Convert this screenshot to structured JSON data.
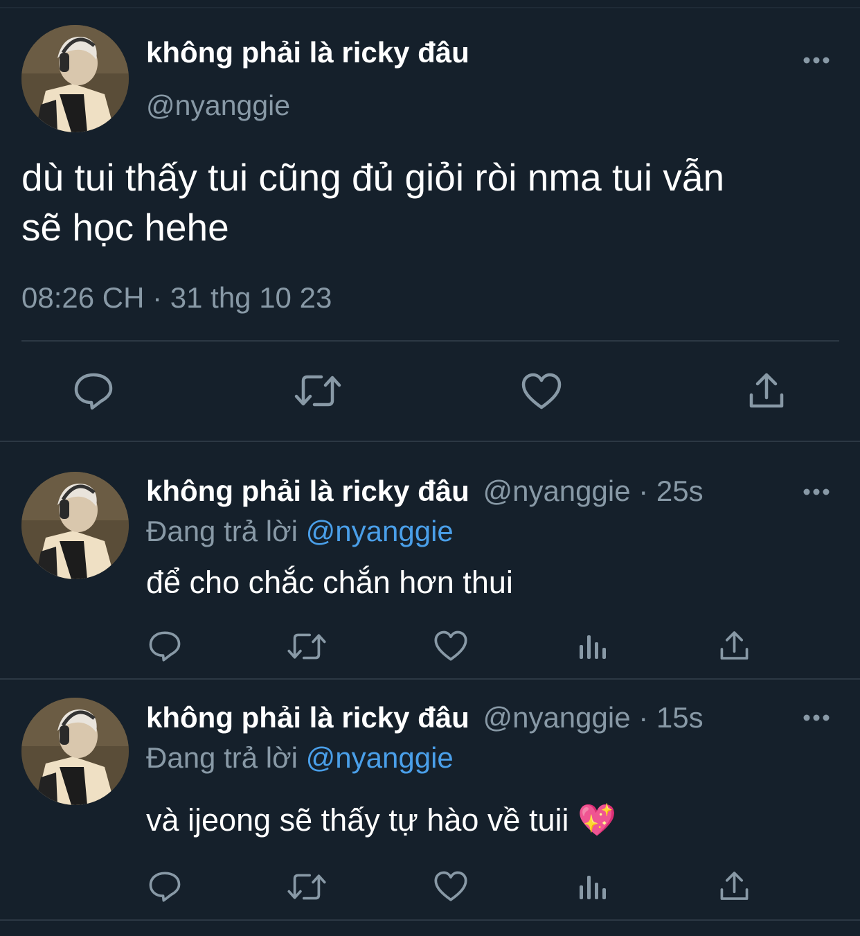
{
  "main_tweet": {
    "display_name": "không phải là ricky đâu",
    "handle": "@nyanggie",
    "text_line1": "dù tui thấy tui cũng đủ giỏi ròi nma tui vẫn",
    "text_line2": "sẽ học hehe",
    "timestamp": "08:26 CH · 31 thg 10 23",
    "icons": [
      "reply-icon",
      "retweet-icon",
      "like-icon",
      "share-icon"
    ]
  },
  "replies": [
    {
      "display_name": "không phải là ricky đâu",
      "handle_time": "@nyanggie · 25s",
      "replying_prefix": "Đang trả lời",
      "replying_handle": "@nyanggie",
      "text": "để cho chắc chắn hơn thui",
      "emoji": "",
      "icons": [
        "reply-icon",
        "retweet-icon",
        "like-icon",
        "analytics-icon",
        "share-icon"
      ]
    },
    {
      "display_name": "không phải là ricky đâu",
      "handle_time": "@nyanggie · 15s",
      "replying_prefix": "Đang trả lời",
      "replying_handle": "@nyanggie",
      "text": "và ijeong sẽ thấy tự hào về tuii",
      "emoji": "💖",
      "icons": [
        "reply-icon",
        "retweet-icon",
        "like-icon",
        "analytics-icon",
        "share-icon"
      ]
    }
  ],
  "colors": {
    "background": "#15202b",
    "text": "#ffffff",
    "muted": "#8899a6",
    "link": "#4a9fe9",
    "divider": "#2c3844",
    "emoji_heart": "#ff5fa8"
  }
}
